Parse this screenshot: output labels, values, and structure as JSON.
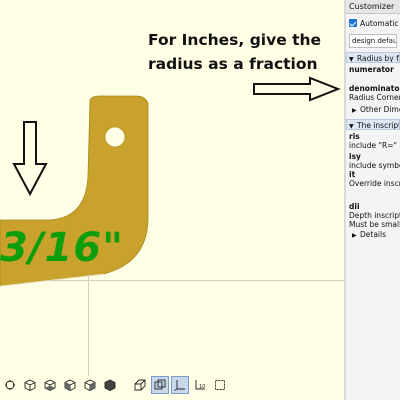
{
  "viewport": {
    "part_text": "3/16\"",
    "annotation": {
      "line1": "For Inches, give the",
      "line2": "radius as a fraction"
    },
    "colors": {
      "part": "#c8a22c",
      "part_text": "#0d9e0d",
      "background": "#ffffe5"
    }
  },
  "toolbar": {
    "buttons": [
      {
        "icon": "view-all-icon"
      },
      {
        "icon": "view-top-icon"
      },
      {
        "icon": "view-bottom-icon"
      },
      {
        "icon": "view-left-icon"
      },
      {
        "icon": "view-right-icon"
      },
      {
        "icon": "view-front-icon"
      },
      {
        "icon": "perspective-icon"
      },
      {
        "icon": "orthogonal-icon"
      },
      {
        "icon": "show-axes-icon"
      },
      {
        "icon": "show-scale-icon"
      },
      {
        "icon": "show-edges-icon"
      }
    ],
    "scale_label": "10"
  },
  "customizer": {
    "title": "Customizer",
    "auto_preview_label": "Automatic Preview",
    "preset_value": "design default values",
    "groups": {
      "radius": {
        "header": "Radius by fraction",
        "numerator_name": "numerator",
        "denominator_name": "denominator",
        "denominator_desc": "Radius Corner given as fraction",
        "other_dimensions": "Other Dimensions"
      },
      "inscription": {
        "header": "The inscription",
        "ris_name": "ris",
        "ris_desc": "include \"R=\"",
        "isy_name": "isy",
        "isy_desc": "include symbol \"",
        "it_name": "it",
        "it_desc": "Override inscription",
        "dii_name": "dii",
        "dii_desc1": "Depth inscription",
        "dii_desc2": "Must be smaller",
        "details": "Details"
      }
    }
  }
}
